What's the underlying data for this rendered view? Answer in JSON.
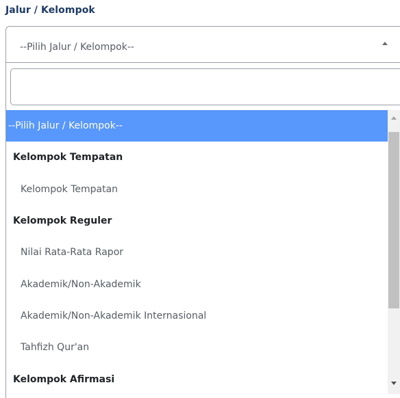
{
  "field": {
    "label": "Jalur / Kelompok",
    "selected": "--Pilih Jalur / Kelompok--"
  },
  "search": {
    "value": "",
    "placeholder": ""
  },
  "options": [
    {
      "label": "--Pilih Jalur / Kelompok--",
      "kind": "placeholder",
      "highlighted": true
    },
    {
      "label": "Kelompok Tempatan",
      "kind": "group"
    },
    {
      "label": "Kelompok Tempatan",
      "kind": "child"
    },
    {
      "label": "Kelompok Reguler",
      "kind": "group"
    },
    {
      "label": "Nilai Rata-Rata Rapor",
      "kind": "child"
    },
    {
      "label": "Akademik/Non-Akademik",
      "kind": "child"
    },
    {
      "label": "Akademik/Non-Akademik Internasional",
      "kind": "child"
    },
    {
      "label": "Tahfizh Qur'an",
      "kind": "child"
    },
    {
      "label": "Kelompok Afirmasi",
      "kind": "group"
    }
  ],
  "colors": {
    "label": "#1d3a66",
    "highlight": "#5897fb"
  },
  "icons": {
    "select_arrow": "caret-up-icon",
    "scroll_up": "scroll-up-icon",
    "scroll_down": "scroll-down-icon"
  }
}
